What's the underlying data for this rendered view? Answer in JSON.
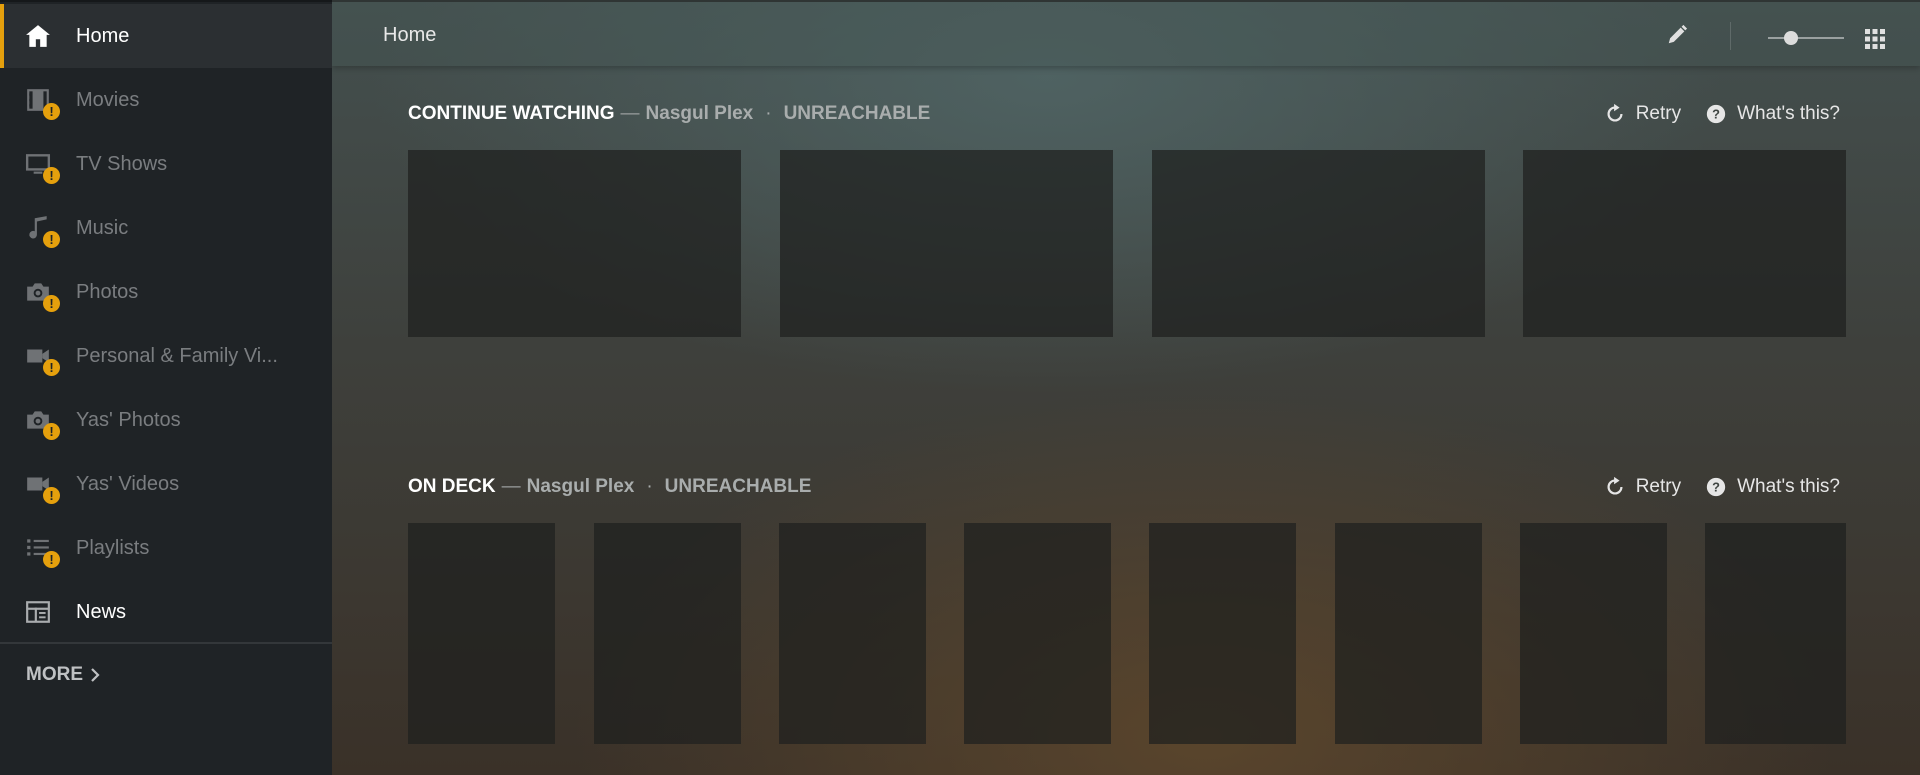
{
  "sidebar": {
    "items": [
      {
        "label": "Home",
        "icon": "home-icon",
        "warning": false
      },
      {
        "label": "Movies",
        "icon": "film-icon",
        "warning": true
      },
      {
        "label": "TV Shows",
        "icon": "tv-icon",
        "warning": true
      },
      {
        "label": "Music",
        "icon": "music-icon",
        "warning": true
      },
      {
        "label": "Photos",
        "icon": "camera-icon",
        "warning": true
      },
      {
        "label": "Personal & Family Vi...",
        "icon": "video-camera-icon",
        "warning": true
      },
      {
        "label": "Yas' Photos",
        "icon": "camera-icon",
        "warning": true
      },
      {
        "label": "Yas' Videos",
        "icon": "video-camera-icon",
        "warning": true
      },
      {
        "label": "Playlists",
        "icon": "playlist-icon",
        "warning": true
      },
      {
        "label": "News",
        "icon": "news-icon",
        "warning": false
      }
    ],
    "warning_glyph": "!",
    "more_label": "MORE"
  },
  "topbar": {
    "title": "Home"
  },
  "hubs": {
    "continue_watching": {
      "title": "CONTINUE WATCHING",
      "dash": "—",
      "server": "Nasgul Plex",
      "dot": "·",
      "status": "UNREACHABLE",
      "retry_label": "Retry",
      "whats_this_label": "What's this?"
    },
    "on_deck": {
      "title": "ON DECK",
      "dash": "—",
      "server": "Nasgul Plex",
      "dot": "·",
      "status": "UNREACHABLE",
      "retry_label": "Retry",
      "whats_this_label": "What's this?"
    }
  },
  "colors": {
    "accent": "#e5a00d",
    "sidebar_bg": "#1f2326"
  }
}
